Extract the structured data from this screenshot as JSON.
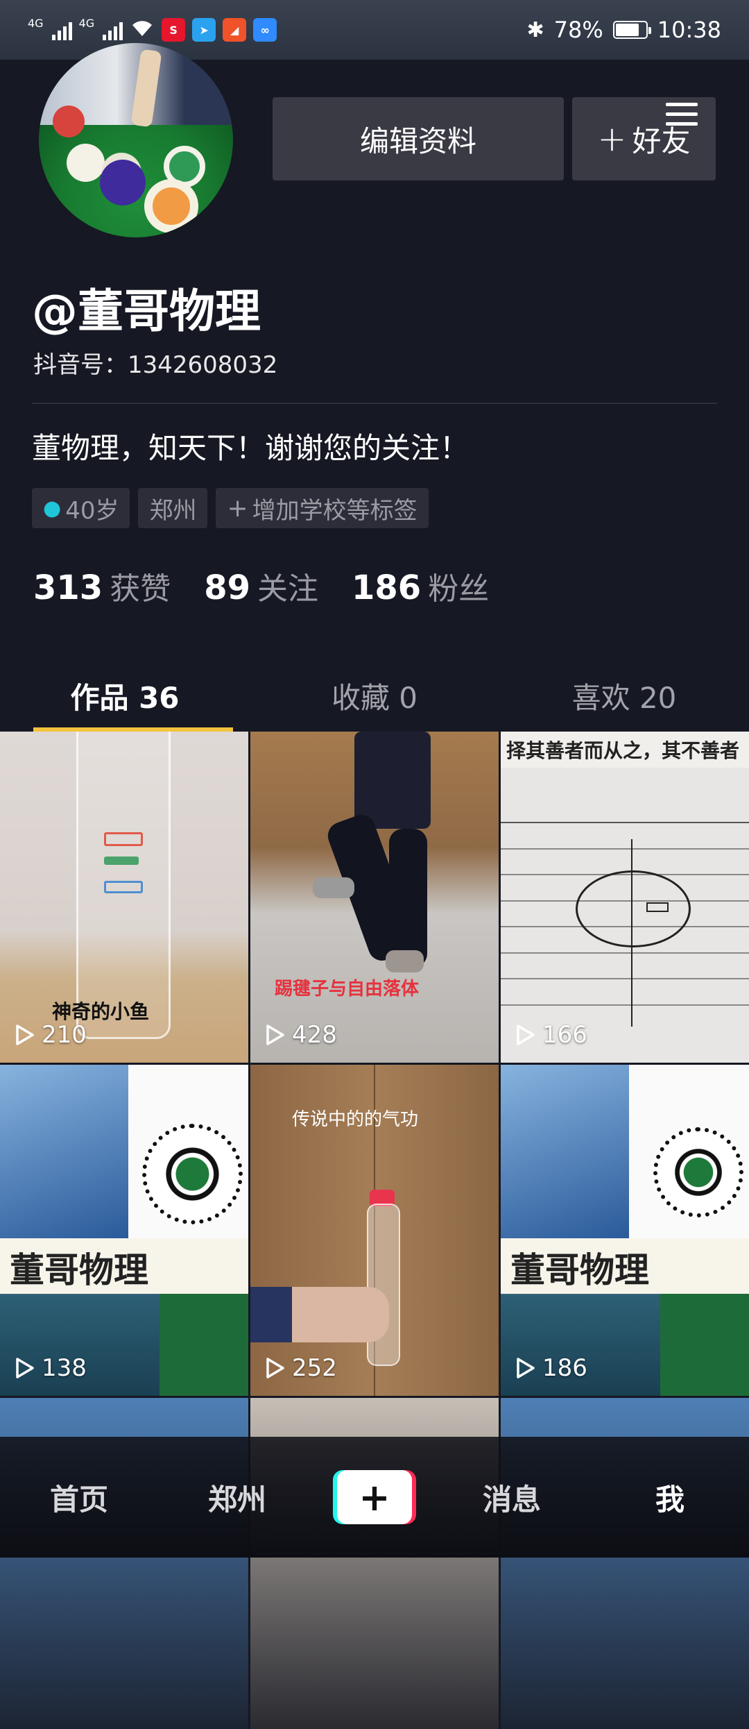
{
  "status_bar": {
    "net1": "4G",
    "net2": "4G",
    "battery": "78%",
    "battery_level": 0.78,
    "time": "10:38",
    "app_icons": [
      {
        "name": "weibo-icon",
        "color": "#e6162d"
      },
      {
        "name": "messenger-icon",
        "color": "#2aa2f0"
      },
      {
        "name": "send-icon",
        "color": "#f0522a"
      },
      {
        "name": "infinity-icon",
        "color": "#2f8bff"
      }
    ]
  },
  "profile": {
    "edit_label": "编辑资料",
    "add_friend_label": "好友",
    "username": "@董哥物理",
    "douyin_id": "抖音号：1342608032",
    "bio": "董物理，知天下！谢谢您的关注！",
    "tags": {
      "age": "40岁",
      "city": "郑州",
      "add": "增加学校等标签"
    },
    "stats": {
      "likes_count": "313",
      "likes_label": "获赞",
      "following_count": "89",
      "following_label": "关注",
      "followers_count": "186",
      "followers_label": "粉丝"
    }
  },
  "tabs": {
    "works": "作品 36",
    "favorites": "收藏 0",
    "likes": "喜欢 20"
  },
  "videos": [
    {
      "plays": "210",
      "caption": "神奇的小鱼"
    },
    {
      "plays": "428",
      "caption": "踢毽子与自由落体"
    },
    {
      "plays": "166",
      "caption": "择其善者而从之，其不善者"
    },
    {
      "plays": "138",
      "caption": "董哥物理"
    },
    {
      "plays": "252",
      "caption": "传说中的的气功"
    },
    {
      "plays": "186",
      "caption": "董哥物理"
    }
  ],
  "bottom_nav": {
    "home": "首页",
    "city": "郑州",
    "add": "+",
    "messages": "消息",
    "me": "我"
  },
  "colors": {
    "background": "#161823",
    "tab_indicator": "#f4c33d",
    "tag_bg": "#2c2d38",
    "button_bg": "#3a3a45"
  }
}
